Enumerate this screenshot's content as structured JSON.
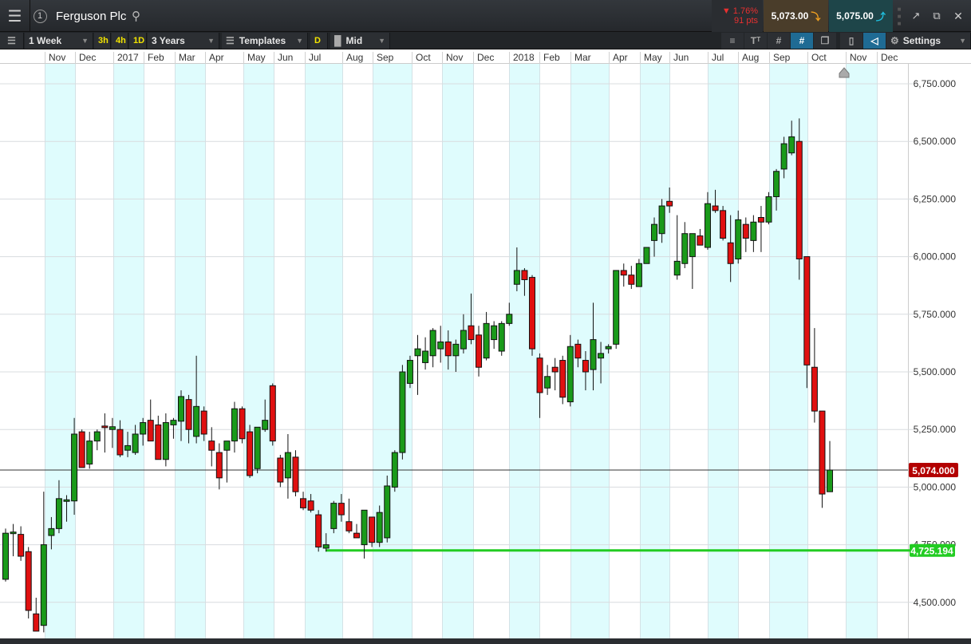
{
  "header": {
    "title": "Ferguson Plc",
    "tab_number": "1",
    "change_pct": "1.76%",
    "change_pts": "91 pts",
    "sell_price": "5,073.00",
    "buy_price": "5,075.00"
  },
  "toolbar": {
    "interval": "1 Week",
    "quick": [
      "3h",
      "4h",
      "1D"
    ],
    "range": "3 Years",
    "templates": "Templates",
    "d_label": "D",
    "price_type": "Mid",
    "settings": "Settings"
  },
  "colors": {
    "up": "#1a9a1a",
    "down": "#e01010",
    "shade": "#dffcfd",
    "current": "#b30000",
    "support": "#22cc22"
  },
  "chart_data": {
    "type": "candlestick",
    "title": "Ferguson Plc",
    "interval": "1 Week",
    "months": [
      "Nov",
      "Dec",
      "2017",
      "Feb",
      "Mar",
      "Apr",
      "May",
      "Jun",
      "Jul",
      "Aug",
      "Sep",
      "Oct",
      "Nov",
      "Dec",
      "2018",
      "Feb",
      "Mar",
      "Apr",
      "May",
      "Jun",
      "Jul",
      "Aug",
      "Sep",
      "Oct",
      "Nov",
      "Dec"
    ],
    "yticks": [
      "6,750.000",
      "6,500.000",
      "6,250.000",
      "6,000.000",
      "5,750.000",
      "5,500.000",
      "5,250.000",
      "5,000.000",
      "4,750.000",
      "4,500.000"
    ],
    "ytick_values": [
      6750,
      6500,
      6250,
      6000,
      5750,
      5500,
      5250,
      5000,
      4750,
      4500
    ],
    "current_price": 5074,
    "current_price_label": "5,074.000",
    "support_level": 4725.194,
    "support_label": "4,725.194",
    "candles": [
      [
        4600,
        4820,
        4590,
        4800
      ],
      [
        4805,
        4840,
        4700,
        4805
      ],
      [
        4795,
        4830,
        4680,
        4700
      ],
      [
        4720,
        4740,
        4430,
        4465
      ],
      [
        4450,
        4520,
        4390,
        4375
      ],
      [
        4400,
        4980,
        4370,
        4750
      ],
      [
        4790,
        4870,
        4730,
        4820
      ],
      [
        4820,
        5030,
        4800,
        4950
      ],
      [
        4945,
        4965,
        4850,
        4945
      ],
      [
        4940,
        5300,
        4880,
        5230
      ],
      [
        5240,
        5250,
        5090,
        5085
      ],
      [
        5100,
        5240,
        5080,
        5200
      ],
      [
        5200,
        5250,
        5160,
        5240
      ],
      [
        5265,
        5320,
        5150,
        5260
      ],
      [
        5250,
        5300,
        5170,
        5262
      ],
      [
        5250,
        5290,
        5130,
        5140
      ],
      [
        5160,
        5240,
        5130,
        5180
      ],
      [
        5150,
        5270,
        5140,
        5230
      ],
      [
        5230,
        5300,
        5180,
        5280
      ],
      [
        5290,
        5380,
        5200,
        5200
      ],
      [
        5270,
        5310,
        5120,
        5120
      ],
      [
        5120,
        5320,
        5090,
        5280
      ],
      [
        5270,
        5300,
        5210,
        5290
      ],
      [
        5286,
        5420,
        5200,
        5393
      ],
      [
        5380,
        5400,
        5190,
        5250
      ],
      [
        5220,
        5570,
        5190,
        5350
      ],
      [
        5330,
        5350,
        5200,
        5230
      ],
      [
        5200,
        5260,
        5090,
        5160
      ],
      [
        5150,
        5190,
        4990,
        5040
      ],
      [
        5160,
        5190,
        5020,
        5200
      ],
      [
        5200,
        5370,
        5150,
        5340
      ],
      [
        5340,
        5350,
        5190,
        5210
      ],
      [
        5240,
        5270,
        5040,
        5050
      ],
      [
        5080,
        5250,
        5060,
        5260
      ],
      [
        5250,
        5380,
        5240,
        5290
      ],
      [
        5440,
        5450,
        5180,
        5200
      ],
      [
        5126,
        5140,
        5000,
        5022
      ],
      [
        5040,
        5230,
        4950,
        5150
      ],
      [
        5130,
        5160,
        4960,
        4980
      ],
      [
        4950,
        4980,
        4900,
        4910
      ],
      [
        4940,
        4970,
        4890,
        4900
      ],
      [
        4880,
        4900,
        4720,
        4740
      ],
      [
        4735,
        4800,
        4720,
        4750
      ],
      [
        4820,
        4940,
        4800,
        4930
      ],
      [
        4930,
        4970,
        4850,
        4880
      ],
      [
        4850,
        4950,
        4800,
        4810
      ],
      [
        4800,
        4840,
        4780,
        4780
      ],
      [
        4750,
        4900,
        4690,
        4900
      ],
      [
        4870,
        4870,
        4740,
        4760
      ],
      [
        4760,
        4920,
        4740,
        4890
      ],
      [
        4780,
        5050,
        4760,
        5005
      ],
      [
        5000,
        5160,
        4980,
        5150
      ],
      [
        5150,
        5530,
        5120,
        5500
      ],
      [
        5450,
        5570,
        5430,
        5550
      ],
      [
        5570,
        5660,
        5400,
        5600
      ],
      [
        5540,
        5650,
        5510,
        5590
      ],
      [
        5570,
        5690,
        5520,
        5680
      ],
      [
        5600,
        5700,
        5540,
        5630
      ],
      [
        5630,
        5680,
        5510,
        5570
      ],
      [
        5570,
        5640,
        5500,
        5620
      ],
      [
        5600,
        5750,
        5580,
        5680
      ],
      [
        5700,
        5840,
        5620,
        5640
      ],
      [
        5660,
        5700,
        5480,
        5520
      ],
      [
        5560,
        5760,
        5550,
        5710
      ],
      [
        5640,
        5720,
        5600,
        5700
      ],
      [
        5590,
        5720,
        5570,
        5710
      ],
      [
        5710,
        5800,
        5700,
        5750
      ],
      [
        5880,
        6040,
        5850,
        5940
      ],
      [
        5940,
        5950,
        5830,
        5900
      ],
      [
        5910,
        5920,
        5570,
        5600
      ],
      [
        5560,
        5580,
        5300,
        5410
      ],
      [
        5430,
        5530,
        5400,
        5480
      ],
      [
        5520,
        5560,
        5420,
        5500
      ],
      [
        5550,
        5570,
        5360,
        5390
      ],
      [
        5370,
        5660,
        5350,
        5610
      ],
      [
        5620,
        5640,
        5520,
        5560
      ],
      [
        5550,
        5590,
        5420,
        5500
      ],
      [
        5510,
        5800,
        5420,
        5640
      ],
      [
        5560,
        5630,
        5450,
        5580
      ],
      [
        5600,
        5620,
        5580,
        5610
      ],
      [
        5620,
        5940,
        5600,
        5940
      ],
      [
        5940,
        5970,
        5870,
        5920
      ],
      [
        5920,
        5960,
        5860,
        5880
      ],
      [
        5870,
        5990,
        5870,
        5970
      ],
      [
        5970,
        6020,
        5970,
        6040
      ],
      [
        6070,
        6170,
        6000,
        6140
      ],
      [
        6100,
        6250,
        6060,
        6220
      ],
      [
        6240,
        6300,
        6190,
        6220
      ],
      [
        5920,
        6180,
        5900,
        5980
      ],
      [
        5970,
        6150,
        5950,
        6100
      ],
      [
        6000,
        6080,
        5860,
        6100
      ],
      [
        6090,
        6120,
        6050,
        6050
      ],
      [
        6040,
        6280,
        6030,
        6230
      ],
      [
        6220,
        6290,
        6190,
        6200
      ],
      [
        6200,
        6220,
        6070,
        6080
      ],
      [
        6060,
        6180,
        5890,
        5970
      ],
      [
        5990,
        6200,
        5970,
        6160
      ],
      [
        6140,
        6170,
        6020,
        6080
      ],
      [
        6070,
        6180,
        6020,
        6150
      ],
      [
        6170,
        6220,
        6020,
        6150
      ],
      [
        6150,
        6280,
        6140,
        6260
      ],
      [
        6260,
        6380,
        6200,
        6370
      ],
      [
        6380,
        6520,
        6340,
        6490
      ],
      [
        6450,
        6590,
        6440,
        6520
      ],
      [
        6500,
        6600,
        5900,
        5990
      ],
      [
        6000,
        6000,
        5430,
        5530
      ],
      [
        5520,
        5690,
        5280,
        5330
      ],
      [
        5330,
        5330,
        4910,
        4970
      ],
      [
        4980,
        5200,
        4980,
        5074
      ]
    ]
  }
}
